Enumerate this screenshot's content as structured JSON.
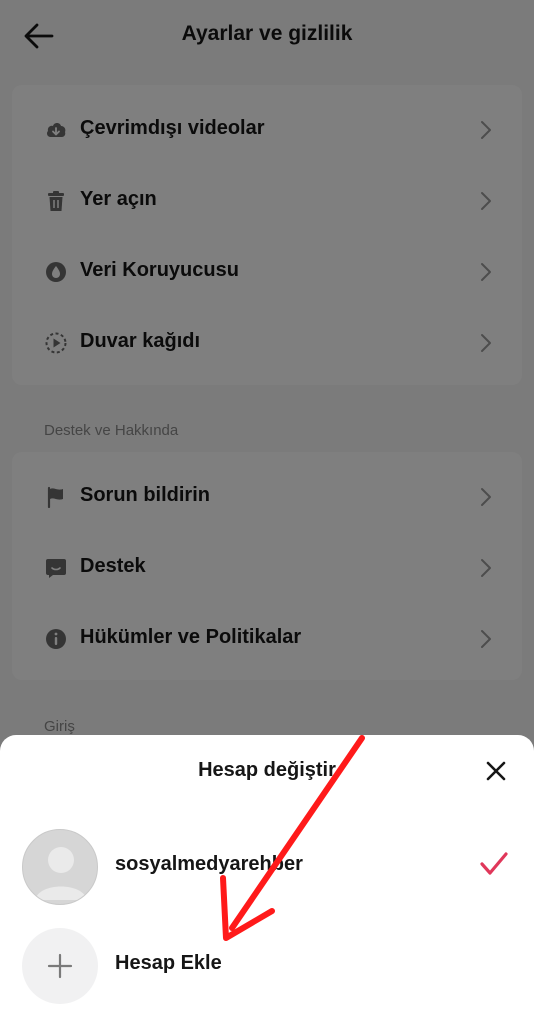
{
  "header": {
    "title": "Ayarlar ve gizlilik"
  },
  "card1": {
    "items": [
      {
        "label": "Çevrimdışı videolar",
        "icon": "download-cloud-icon"
      },
      {
        "label": "Yer açın",
        "icon": "trash-icon"
      },
      {
        "label": "Veri Koruyucusu",
        "icon": "data-saver-icon"
      },
      {
        "label": "Duvar kağıdı",
        "icon": "play-dashed-circle-icon"
      }
    ]
  },
  "section_support": "Destek ve Hakkında",
  "card2": {
    "items": [
      {
        "label": "Sorun bildirin",
        "icon": "flag-icon"
      },
      {
        "label": "Destek",
        "icon": "chat-icon"
      },
      {
        "label": "Hükümler ve Politikalar",
        "icon": "info-icon"
      }
    ]
  },
  "section_login": "Giriş",
  "sheet": {
    "title": "Hesap değiştir",
    "account_name": "sosyalmedyarehber",
    "add_account_label": "Hesap Ekle"
  },
  "colors": {
    "check": "#e0375a",
    "annotation_arrow": "#ff1a1a"
  }
}
